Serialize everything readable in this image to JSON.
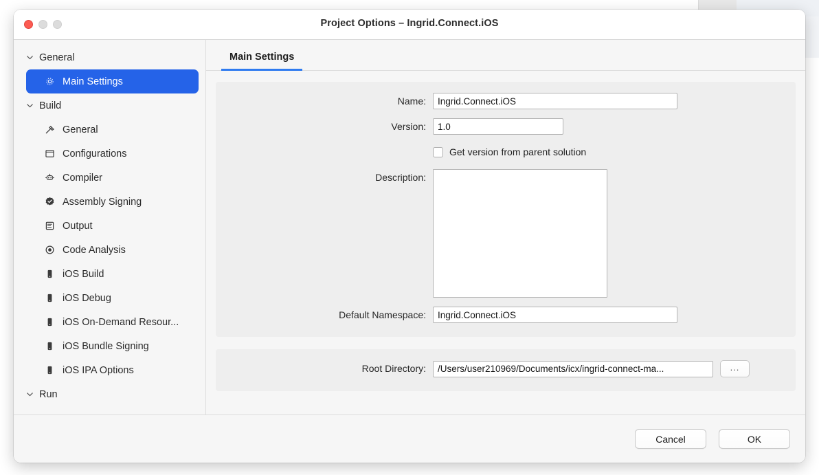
{
  "window": {
    "title": "Project Options – Ingrid.Connect.iOS",
    "traffic_lights": {
      "close": "close-button",
      "minimize": "minimize-button",
      "maximize": "maximize-button"
    },
    "accent_color": "#2563e8",
    "tab_underline_color": "#2f7bf0"
  },
  "sidebar": {
    "groups": [
      {
        "label": "General",
        "expanded": true
      },
      {
        "label": "Build",
        "expanded": true
      },
      {
        "label": "Run",
        "expanded": true
      }
    ],
    "items": [
      {
        "label": "Main Settings",
        "icon": "gear-icon",
        "selected": true,
        "group": "General"
      },
      {
        "label": "General",
        "icon": "hammer-icon",
        "selected": false,
        "group": "Build"
      },
      {
        "label": "Configurations",
        "icon": "square-icon",
        "selected": false,
        "group": "Build"
      },
      {
        "label": "Compiler",
        "icon": "compiler-icon",
        "selected": false,
        "group": "Build"
      },
      {
        "label": "Assembly Signing",
        "icon": "seal-badge-icon",
        "selected": false,
        "group": "Build"
      },
      {
        "label": "Output",
        "icon": "document-lines-icon",
        "selected": false,
        "group": "Build"
      },
      {
        "label": "Code Analysis",
        "icon": "radio-target-icon",
        "selected": false,
        "group": "Build"
      },
      {
        "label": "iOS Build",
        "icon": "phone-icon",
        "selected": false,
        "group": "Build"
      },
      {
        "label": "iOS Debug",
        "icon": "phone-icon",
        "selected": false,
        "group": "Build"
      },
      {
        "label": "iOS On-Demand Resour...",
        "icon": "phone-icon",
        "selected": false,
        "group": "Build"
      },
      {
        "label": "iOS Bundle Signing",
        "icon": "phone-icon",
        "selected": false,
        "group": "Build"
      },
      {
        "label": "iOS IPA Options",
        "icon": "phone-icon",
        "selected": false,
        "group": "Build"
      }
    ]
  },
  "main": {
    "tabs": [
      {
        "label": "Main Settings",
        "active": true
      }
    ],
    "general_panel": {
      "name_label": "Name:",
      "name_value": "Ingrid.Connect.iOS",
      "version_label": "Version:",
      "version_value": "1.0",
      "parent_version_checkbox_label": "Get version from parent solution",
      "parent_version_checked": false,
      "description_label": "Description:",
      "description_value": "",
      "namespace_label": "Default Namespace:",
      "namespace_value": "Ingrid.Connect.iOS"
    },
    "location_panel": {
      "root_directory_label": "Root Directory:",
      "root_directory_value": "/Users/user210969/Documents/icx/ingrid-connect-ma...",
      "browse_button_label": "..."
    }
  },
  "footer": {
    "cancel_label": "Cancel",
    "ok_label": "OK"
  }
}
